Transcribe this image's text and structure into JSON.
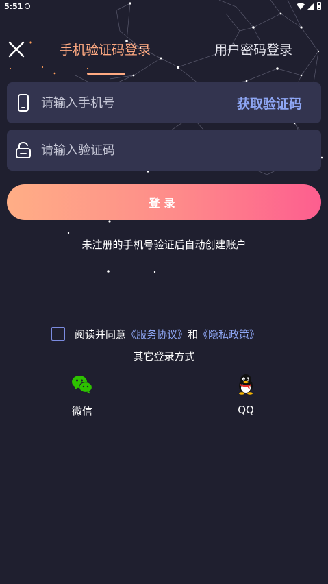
{
  "status_bar": {
    "time": "5:51"
  },
  "nav": {
    "tab_sms": "手机验证码登录",
    "tab_password": "用户密码登录",
    "accent_color": "#ffaa82"
  },
  "phone_field": {
    "placeholder": "请输入手机号",
    "value": "",
    "get_code_label": "获取验证码"
  },
  "code_field": {
    "placeholder": "请输入验证码",
    "value": ""
  },
  "login_button": {
    "label": "登录",
    "gradient": [
      "#ffae86",
      "#fd5e8f"
    ]
  },
  "hint": "未注册的手机号验证后自动创建账户",
  "agreement": {
    "prefix": "阅读并同意",
    "service_link": "《服务协议》",
    "conjunction": "和",
    "privacy_link": "《隐私政策》",
    "checked": false
  },
  "other_login": {
    "title": "其它登录方式",
    "options": [
      {
        "label": "微信",
        "icon": "wechat-icon"
      },
      {
        "label": "QQ",
        "icon": "qq-icon"
      }
    ]
  },
  "colors": {
    "background": "#1f1f2f",
    "field": "#33344f",
    "link": "#8ea6f4"
  }
}
